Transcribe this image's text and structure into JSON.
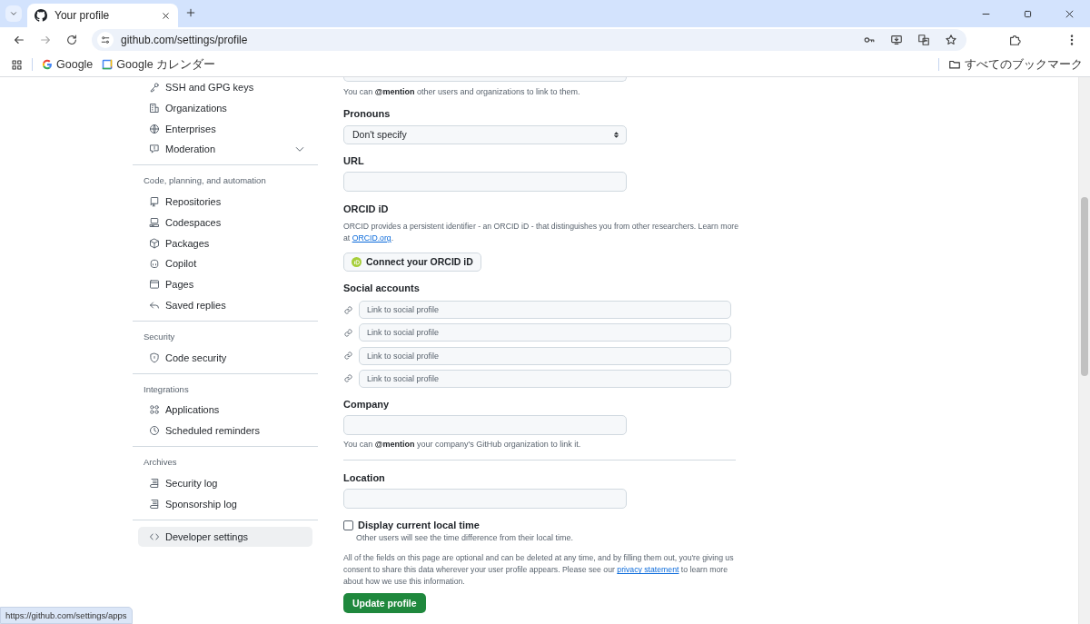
{
  "browser": {
    "tabs": [
      {
        "title": "Your profile",
        "selected": true
      }
    ],
    "address": "github.com/settings/profile",
    "bookmarks": [
      {
        "label": "Google"
      },
      {
        "label": "Google カレンダー"
      }
    ],
    "all_bookmarks": "すべてのブックマーク"
  },
  "sidebar": {
    "groups": [
      {
        "items": [
          {
            "label": "SSH and GPG keys",
            "kind": "link",
            "selected": false
          },
          {
            "label": "Organizations",
            "kind": "link",
            "selected": false
          },
          {
            "label": "Enterprises",
            "kind": "link",
            "selected": false
          },
          {
            "label": "Moderation",
            "kind": "expandable",
            "expanded": false,
            "selected": false
          }
        ]
      },
      {
        "heading": "Code, planning, and automation",
        "items": [
          {
            "label": "Repositories",
            "kind": "link",
            "selected": false
          },
          {
            "label": "Codespaces",
            "kind": "link",
            "selected": false
          },
          {
            "label": "Packages",
            "kind": "link",
            "selected": false
          },
          {
            "label": "Copilot",
            "kind": "link",
            "selected": false
          },
          {
            "label": "Pages",
            "kind": "link",
            "selected": false
          },
          {
            "label": "Saved replies",
            "kind": "link",
            "selected": false
          }
        ]
      },
      {
        "heading": "Security",
        "items": [
          {
            "label": "Code security",
            "kind": "link",
            "selected": false
          }
        ]
      },
      {
        "heading": "Integrations",
        "items": [
          {
            "label": "Applications",
            "kind": "link",
            "selected": false
          },
          {
            "label": "Scheduled reminders",
            "kind": "link",
            "selected": false
          }
        ]
      },
      {
        "heading": "Archives",
        "items": [
          {
            "label": "Security log",
            "kind": "link",
            "selected": false
          },
          {
            "label": "Sponsorship log",
            "kind": "link",
            "selected": false
          }
        ]
      },
      {
        "items": [
          {
            "label": "Developer settings",
            "kind": "link",
            "selected": true
          }
        ]
      }
    ]
  },
  "form": {
    "sections": [
      {
        "kind": "textarea",
        "hint": "You can **@mention** other users and organizations to link to them."
      },
      {
        "kind": "select",
        "label": "Pronouns",
        "value": "Don't specify"
      },
      {
        "kind": "text",
        "label": "URL"
      },
      {
        "kind": "orcid",
        "label": "ORCID iD",
        "description": "ORCID provides a persistent identifier - an ORCID iD - that distinguishes you from other researchers. Learn more at",
        "link": "ORCID.org",
        "after_link": ".",
        "button": "Connect your ORCID iD"
      },
      {
        "kind": "social",
        "label": "Social accounts",
        "inputs": [
          {
            "placeholder": "Link to social profile"
          },
          {
            "placeholder": "Link to social profile"
          },
          {
            "placeholder": "Link to social profile"
          },
          {
            "placeholder": "Link to social profile"
          }
        ]
      },
      {
        "kind": "text",
        "label": "Company",
        "hint": "You can **@mention** your company's GitHub organization to link it."
      },
      {
        "kind": "divider"
      },
      {
        "kind": "text",
        "label": "Location"
      },
      {
        "kind": "checkbox",
        "label": "Display current local time",
        "checked": false,
        "hint": "Other users will see the time difference from their local time."
      },
      {
        "kind": "notice",
        "text_before": "All of the fields on this page are optional and can be deleted at any time, and by filling them out, you're giving us consent to share this data wherever your user profile appears. Please see our",
        "link": "privacy statement",
        "text_after": "to learn more about how we use this information."
      },
      {
        "kind": "submit",
        "label": "Update profile"
      }
    ]
  },
  "status_url": "https://github.com/settings/apps"
}
